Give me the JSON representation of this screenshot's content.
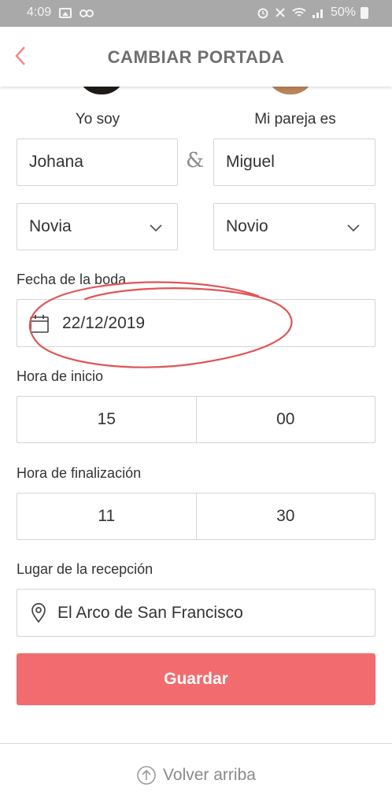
{
  "status_bar": {
    "time": "4:09",
    "battery": "50%"
  },
  "header": {
    "title": "CAMBIAR PORTADA",
    "back_icon": "chevron-left-icon"
  },
  "couple": {
    "me_label": "Yo soy",
    "partner_label": "Mi pareja es",
    "me_name": "Johana",
    "partner_name": "Miguel",
    "ampersand": "&",
    "me_role": "Novia",
    "partner_role": "Novio"
  },
  "wedding_date": {
    "label": "Fecha de la boda",
    "value": "22/12/2019",
    "icon": "calendar-icon"
  },
  "start_time": {
    "label": "Hora de inicio",
    "hour": "15",
    "minute": "00"
  },
  "end_time": {
    "label": "Hora de finalización",
    "hour": "11",
    "minute": "30"
  },
  "reception": {
    "label": "Lugar de la recepción",
    "value": "El Arco de San Francisco",
    "icon": "location-pin-icon"
  },
  "save_button": {
    "label": "Guardar"
  },
  "footer": {
    "scroll_top_label": "Volver arriba",
    "icon": "arrow-up-circle-icon"
  },
  "colors": {
    "accent": "#f26c6f",
    "back_arrow": "#f08a8a",
    "annotation": "#e05555"
  }
}
